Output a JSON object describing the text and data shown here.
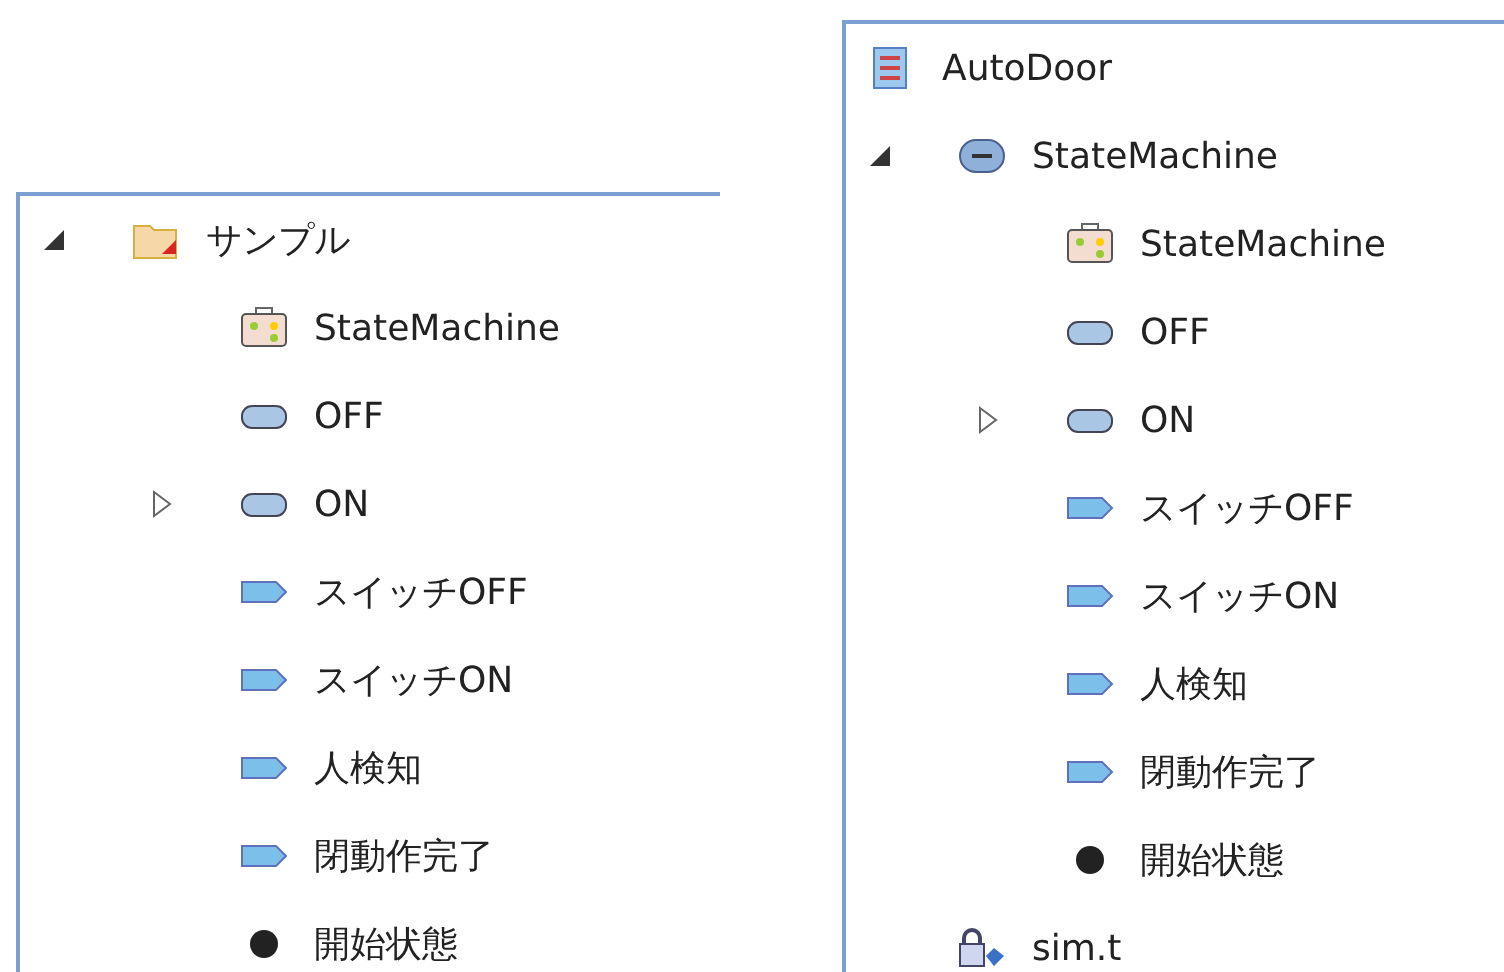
{
  "panels": [
    {
      "tree": [
        {
          "label": "サンプル",
          "kind": "package",
          "expanded": true,
          "children": [
            {
              "label": "StateMachine",
              "kind": "diagram"
            },
            {
              "label": "OFF",
              "kind": "state"
            },
            {
              "label": "ON",
              "kind": "state",
              "expanded": false
            },
            {
              "label": "スイッチOFF",
              "kind": "trigger"
            },
            {
              "label": "スイッチON",
              "kind": "trigger"
            },
            {
              "label": "人検知",
              "kind": "trigger"
            },
            {
              "label": "閉動作完了",
              "kind": "trigger"
            },
            {
              "label": "開始状態",
              "kind": "initial"
            }
          ]
        }
      ]
    },
    {
      "header": {
        "label": "AutoDoor",
        "kind": "model"
      },
      "tree": [
        {
          "label": "StateMachine",
          "kind": "statemachine",
          "expanded": true,
          "children": [
            {
              "label": "StateMachine",
              "kind": "diagram"
            },
            {
              "label": "OFF",
              "kind": "state"
            },
            {
              "label": "ON",
              "kind": "state",
              "expanded": false
            },
            {
              "label": "スイッチOFF",
              "kind": "trigger"
            },
            {
              "label": "スイッチON",
              "kind": "trigger"
            },
            {
              "label": "人検知",
              "kind": "trigger"
            },
            {
              "label": "閉動作完了",
              "kind": "trigger"
            },
            {
              "label": "開始状態",
              "kind": "initial"
            }
          ]
        },
        {
          "label": "sim.t",
          "kind": "locked-file"
        }
      ]
    }
  ]
}
